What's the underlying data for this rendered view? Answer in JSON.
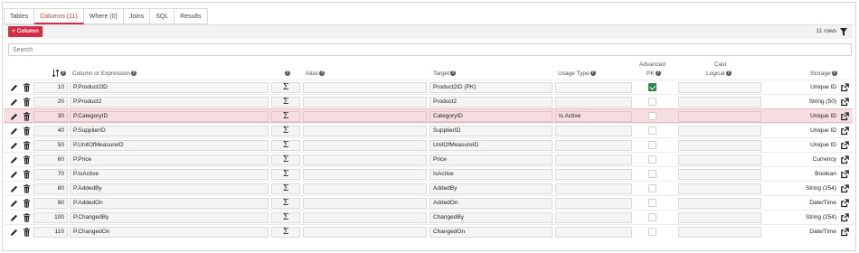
{
  "tabs": [
    {
      "label": "Tables",
      "active": false
    },
    {
      "label": "Columns (11)",
      "active": true
    },
    {
      "label": "Where (0)",
      "active": false
    },
    {
      "label": "Joins",
      "active": false
    },
    {
      "label": "SQL",
      "active": false
    },
    {
      "label": "Results",
      "active": false
    }
  ],
  "toolbar": {
    "add_column_label": "+ Column",
    "rows_count": "11 rows"
  },
  "search": {
    "placeholder": "Search"
  },
  "header": {
    "sort": "",
    "column_or_expression": "Column or Expression",
    "alias": "Alias",
    "target": "Target",
    "usage_type": "Usage Type",
    "advanced": "Advanced",
    "pk": "PK",
    "cast": "Cast",
    "logical": "Logical",
    "storage": "Storage"
  },
  "colors": {
    "accent": "#d62b45",
    "highlight_row": "#f6dde2",
    "check_green": "#1f8a4c"
  },
  "rows": [
    {
      "order": "10",
      "expr": "P.Product2ID",
      "alias": "",
      "target": "Product2ID (PK)",
      "usage": "",
      "pk": true,
      "logical": "",
      "storage": "Unique ID",
      "highlight": false
    },
    {
      "order": "20",
      "expr": "P.Product2",
      "alias": "",
      "target": "Product2",
      "usage": "",
      "pk": false,
      "logical": "",
      "storage": "String (50)",
      "highlight": false
    },
    {
      "order": "30",
      "expr": "P.CategoryID",
      "alias": "",
      "target": "CategoryID",
      "usage": "Is Active",
      "pk": false,
      "logical": "",
      "storage": "Unique ID",
      "highlight": true
    },
    {
      "order": "40",
      "expr": "P.SupplierID",
      "alias": "",
      "target": "SupplierID",
      "usage": "",
      "pk": false,
      "logical": "",
      "storage": "Unique ID",
      "highlight": false
    },
    {
      "order": "50",
      "expr": "P.UnitOfMeasureID",
      "alias": "",
      "target": "UnitOfMeasureID",
      "usage": "",
      "pk": false,
      "logical": "",
      "storage": "Unique ID",
      "highlight": false
    },
    {
      "order": "60",
      "expr": "P.Price",
      "alias": "",
      "target": "Price",
      "usage": "",
      "pk": false,
      "logical": "",
      "storage": "Currency",
      "highlight": false
    },
    {
      "order": "70",
      "expr": "P.IsActive",
      "alias": "",
      "target": "IsActive",
      "usage": "",
      "pk": false,
      "logical": "",
      "storage": "Boolean",
      "highlight": false
    },
    {
      "order": "80",
      "expr": "P.AddedBy",
      "alias": "",
      "target": "AddedBy",
      "usage": "",
      "pk": false,
      "logical": "",
      "storage": "String (254)",
      "highlight": false
    },
    {
      "order": "90",
      "expr": "P.AddedOn",
      "alias": "",
      "target": "AddedOn",
      "usage": "",
      "pk": false,
      "logical": "",
      "storage": "Date/Time",
      "highlight": false
    },
    {
      "order": "100",
      "expr": "P.ChangedBy",
      "alias": "",
      "target": "ChangedBy",
      "usage": "",
      "pk": false,
      "logical": "",
      "storage": "String (254)",
      "highlight": false
    },
    {
      "order": "110",
      "expr": "P.ChangedOn",
      "alias": "",
      "target": "ChangedOn",
      "usage": "",
      "pk": false,
      "logical": "",
      "storage": "Date/Time",
      "highlight": false
    }
  ],
  "sigma_symbol": "Σ"
}
